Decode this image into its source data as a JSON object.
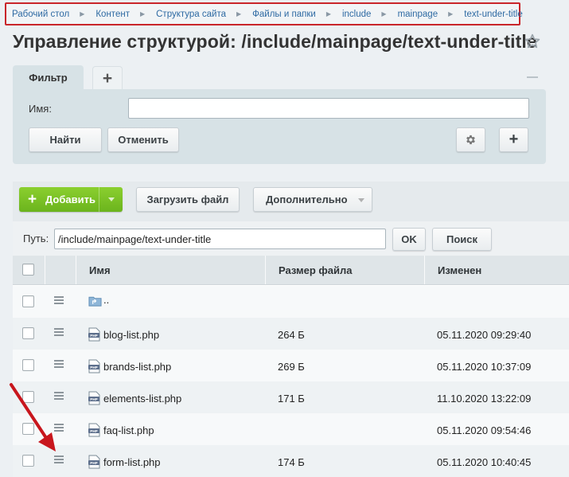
{
  "breadcrumb": [
    "Рабочий стол",
    "Контент",
    "Структура сайта",
    "Файлы и папки",
    "include",
    "mainpage",
    "text-under-title"
  ],
  "page_title": "Управление структурой: /include/mainpage/text-under-title",
  "filter": {
    "tab_label": "Фильтр",
    "add_tab_symbol": "+",
    "name_label": "Имя:",
    "name_value": "",
    "find_label": "Найти",
    "cancel_label": "Отменить",
    "add_symbol": "+"
  },
  "toolbar": {
    "add_label": "Добавить",
    "add_symbol": "+",
    "upload_label": "Загрузить файл",
    "more_label": "Дополнительно"
  },
  "path": {
    "label": "Путь:",
    "value": "/include/mainpage/text-under-title",
    "ok_label": "OK",
    "search_label": "Поиск"
  },
  "table": {
    "columns": [
      "Имя",
      "Размер файла",
      "Изменен"
    ],
    "rows": [
      {
        "name": "..",
        "size": "",
        "date": "",
        "type": "folder-up"
      },
      {
        "name": "blog-list.php",
        "size": "264 Б",
        "date": "05.11.2020 09:29:40",
        "type": "php"
      },
      {
        "name": "brands-list.php",
        "size": "269 Б",
        "date": "05.11.2020 10:37:09",
        "type": "php"
      },
      {
        "name": "elements-list.php",
        "size": "171 Б",
        "date": "11.10.2020 13:22:09",
        "type": "php"
      },
      {
        "name": "faq-list.php",
        "size": "",
        "date": "05.11.2020 09:54:46",
        "type": "php"
      },
      {
        "name": "form-list.php",
        "size": "174 Б",
        "date": "05.11.2020 10:40:45",
        "type": "php"
      }
    ]
  },
  "colors": {
    "highlight_border": "#c9252a",
    "add_button": "#78bd25",
    "annotation_arrow": "#c8161d"
  },
  "icons": [
    "star-icon",
    "gear-icon",
    "menu-icon",
    "php-file-icon",
    "folder-up-icon",
    "caret-down-icon"
  ]
}
